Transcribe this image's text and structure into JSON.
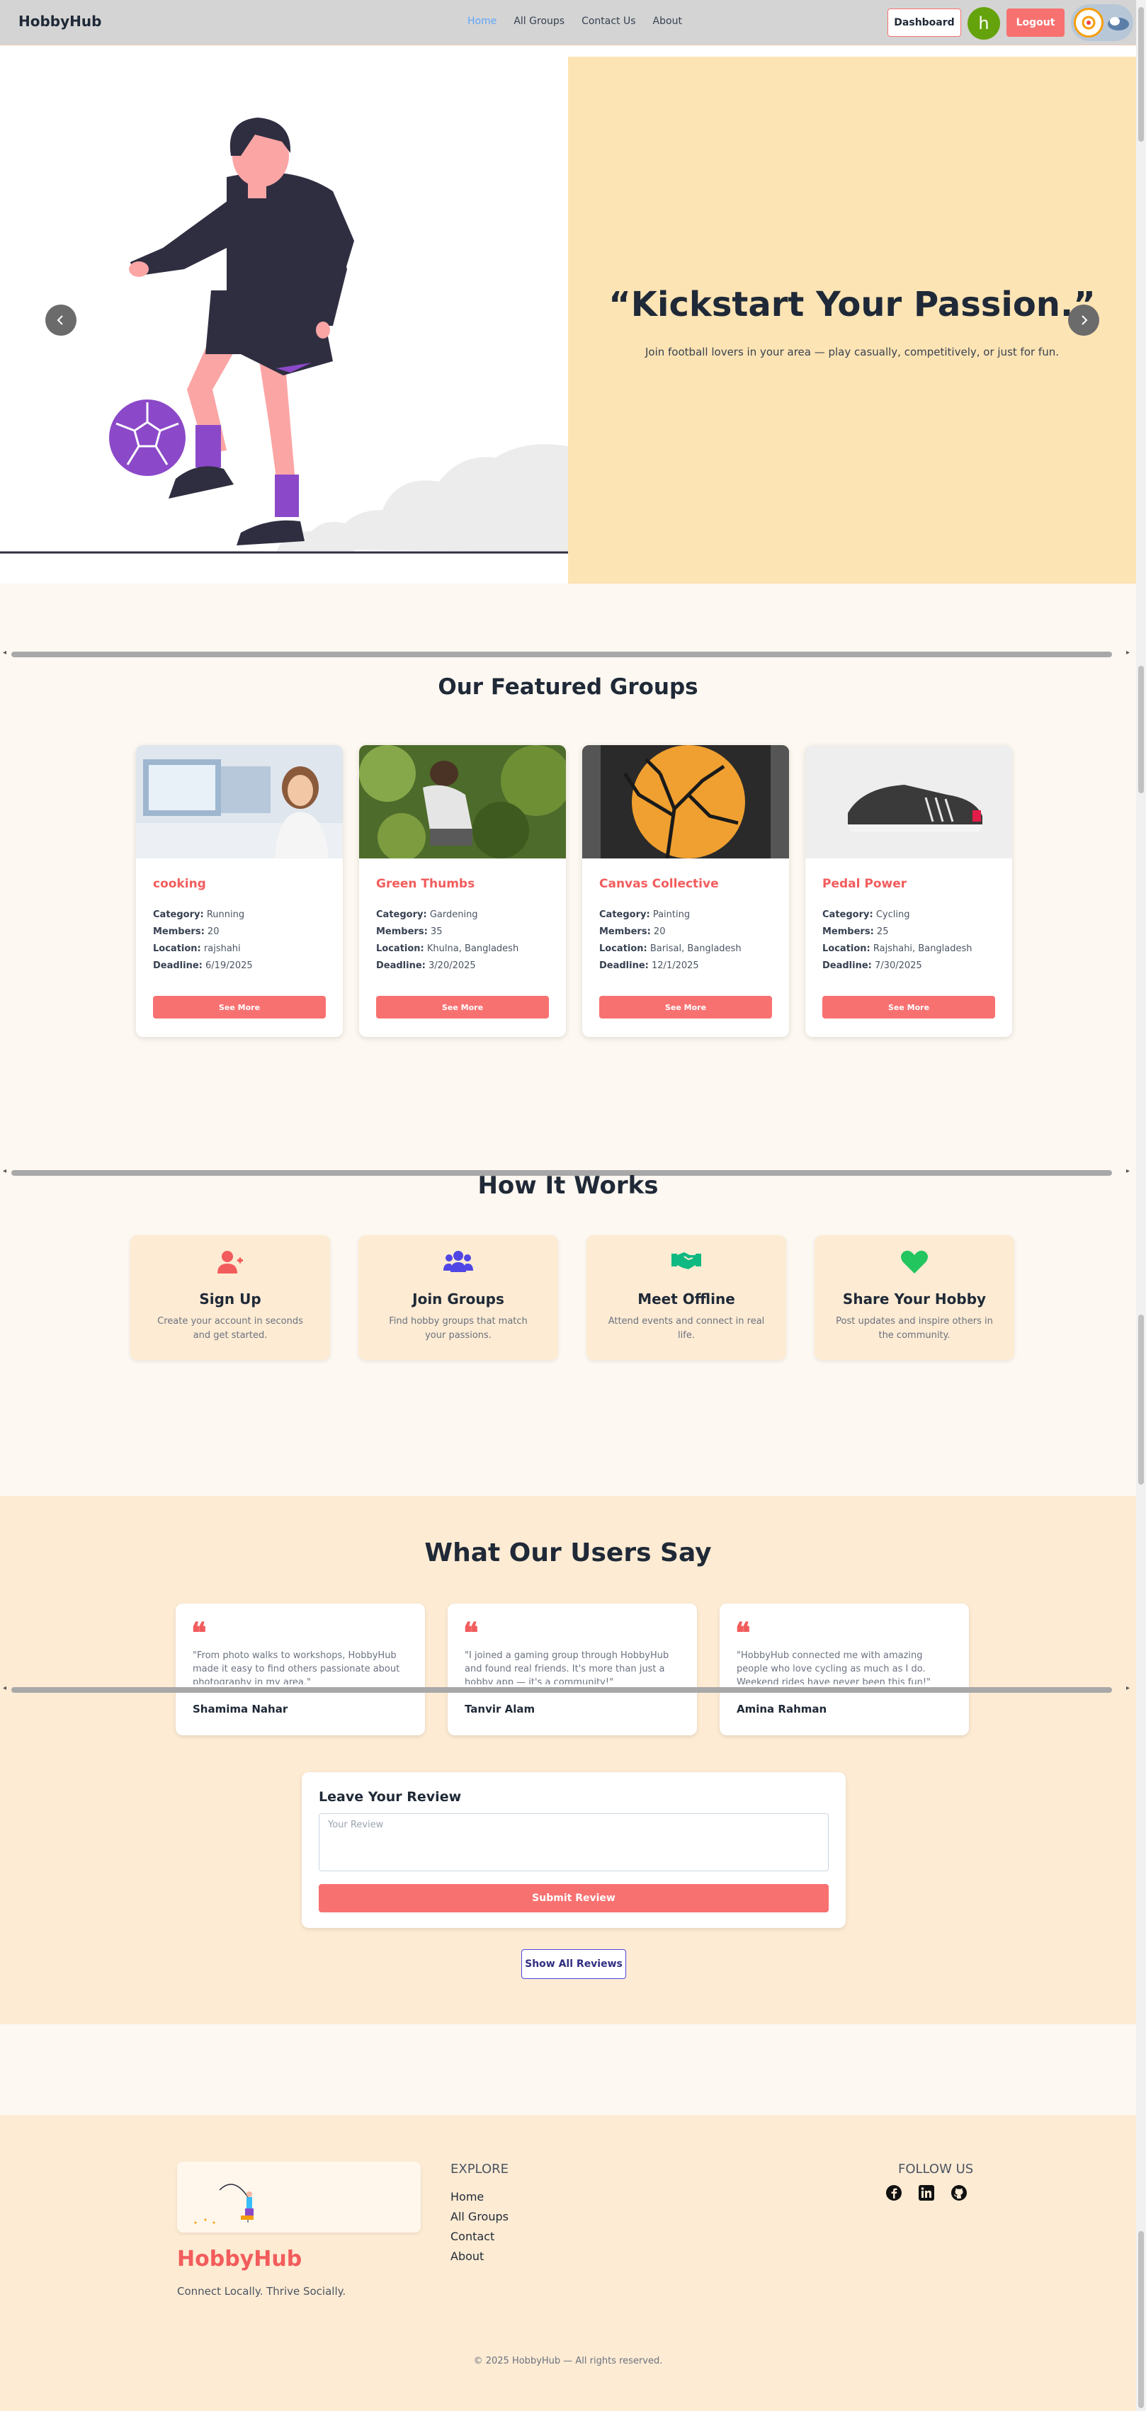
{
  "nav": {
    "brand": "HobbyHub",
    "links": [
      "Home",
      "All Groups",
      "Contact Us",
      "About"
    ],
    "dashboard": "Dashboard",
    "avatar_letter": "h",
    "logout": "Logout"
  },
  "hero": {
    "title": "“Kickstart Your Passion.”",
    "subtitle": "Join football lovers in your area — play casually, competitively, or just for fun.",
    "prev_icon": "chevron-left-icon",
    "next_icon": "chevron-right-icon"
  },
  "featured": {
    "title": "Our Featured Groups",
    "category_label": "Category:",
    "members_label": "Members:",
    "location_label": "Location:",
    "deadline_label": "Deadline:",
    "button": "See More",
    "groups": [
      {
        "name": "cooking",
        "category": "Running",
        "members": "20",
        "location": "rajshahi",
        "deadline": "6/19/2025"
      },
      {
        "name": "Green Thumbs",
        "category": "Gardening",
        "members": "35",
        "location": "Khulna, Bangladesh",
        "deadline": "3/20/2025"
      },
      {
        "name": "Canvas Collective",
        "category": "Painting",
        "members": "20",
        "location": "Barisal, Bangladesh",
        "deadline": "12/1/2025"
      },
      {
        "name": "Pedal Power",
        "category": "Cycling",
        "members": "25",
        "location": "Rajshahi, Bangladesh",
        "deadline": "7/30/2025"
      }
    ]
  },
  "how": {
    "title": "How It Works",
    "steps": [
      {
        "title": "Sign Up",
        "desc": "Create your account in seconds and get started.",
        "icon": "user-plus-icon"
      },
      {
        "title": "Join Groups",
        "desc": "Find hobby groups that match your passions.",
        "icon": "users-icon"
      },
      {
        "title": "Meet Offline",
        "desc": "Attend events and connect in real life.",
        "icon": "handshake-icon"
      },
      {
        "title": "Share Your Hobby",
        "desc": "Post updates and inspire others in the community.",
        "icon": "heart-icon"
      }
    ]
  },
  "testimonials": {
    "title": "What Our Users Say",
    "items": [
      {
        "text": "\"From photo walks to workshops, HobbyHub made it easy to find others passionate about photography in my area.\"",
        "name": "Shamima Nahar"
      },
      {
        "text": "\"I joined a gaming group through HobbyHub and found real friends. It's more than just a hobby app — it's a community!\"",
        "name": "Tanvir Alam"
      },
      {
        "text": "\"HobbyHub connected me with amazing people who love cycling as much as I do. Weekend rides have never been this fun!\"",
        "name": "Amina Rahman"
      }
    ]
  },
  "review": {
    "title": "Leave Your Review",
    "placeholder": "Your Review",
    "submit": "Submit Review",
    "show_all": "Show All Reviews"
  },
  "footer": {
    "brand": "HobbyHub",
    "tagline": "Connect Locally. Thrive Socially.",
    "explore_title": "EXPLORE",
    "explore_links": [
      "Home",
      "All Groups",
      "Contact",
      "About"
    ],
    "follow_title": "FOLLOW US",
    "social_icons": [
      "facebook-icon",
      "linkedin-icon",
      "github-icon"
    ],
    "copyright": "© 2025 HobbyHub — All rights reserved."
  },
  "colors": {
    "accent": "#f25c5c",
    "hero_panel": "#fde4b4",
    "section_bg": "#fdebd3",
    "page_bg": "#fdf8f1"
  }
}
